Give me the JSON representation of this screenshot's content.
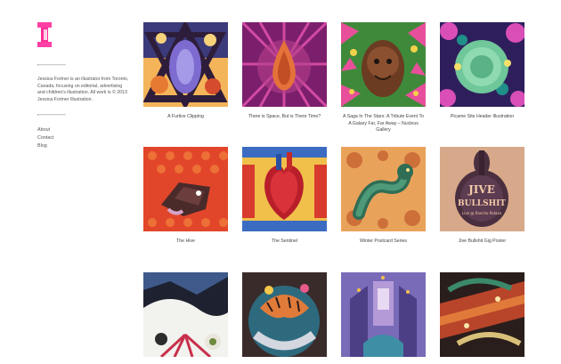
{
  "site": {
    "logo_icon": "pink-i-monogram-icon",
    "bio": "Jessica Fortner is an illustrator from Toronto, Canada, focusing on editorial, advertising and children's illustration. All work is © 2013 Jessica Fortner Illustration.",
    "nav": [
      {
        "label": "About"
      },
      {
        "label": "Contact"
      },
      {
        "label": "Blog"
      }
    ]
  },
  "gallery": {
    "items": [
      {
        "caption": "A Furtive Clipping"
      },
      {
        "caption": "There is Space, But is There Time?"
      },
      {
        "caption": "A Saga In The Stars: A Tribute Event To A Galaxy Far, Far Away – Nucleus Gallery"
      },
      {
        "caption": "Picame Site Header Illustration"
      },
      {
        "caption": "The Hive"
      },
      {
        "caption": "The Sentinel"
      },
      {
        "caption": "Winter Postcard Series"
      },
      {
        "caption": "Jive Bullshit Gig Poster",
        "art_text": [
          "JIVE",
          "BULLSHIT",
          "Live @ Rancho Relaxo"
        ]
      },
      {
        "caption": ""
      },
      {
        "caption": ""
      },
      {
        "caption": ""
      },
      {
        "caption": ""
      }
    ]
  },
  "colors": {
    "logo_pink": "#ff2d95",
    "text": "#444444",
    "rule": "#cfcfcf"
  }
}
